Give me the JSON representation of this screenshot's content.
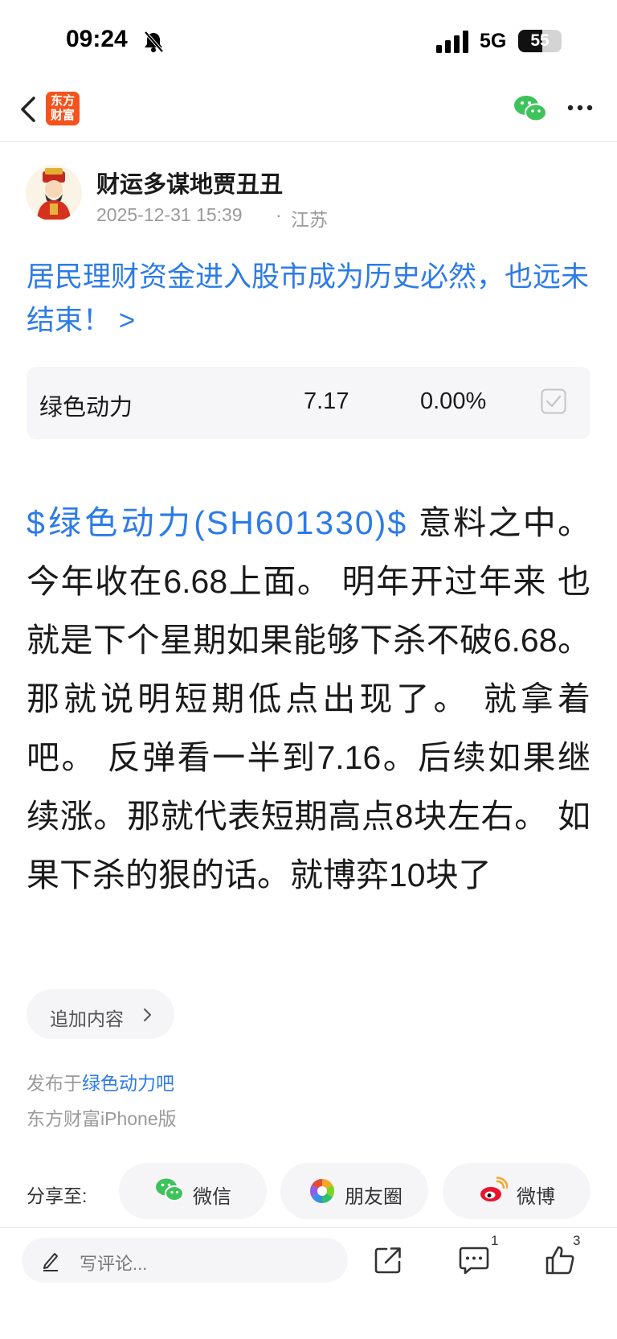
{
  "status_bar": {
    "time": "09:24",
    "network": "5G",
    "battery_level": "55",
    "battery_fraction": 0.55
  },
  "nav": {
    "logo_line1": "东方",
    "logo_line2": "财富",
    "icons": [
      "back-icon",
      "wechat-icon",
      "more-icon"
    ]
  },
  "post": {
    "author_name": "财运多谋地贾丑丑",
    "time": "2025-12-31 15:39",
    "separator": "·",
    "location": "江苏",
    "title": "居民理财资金进入股市成为历史必然，也远未结束！ >",
    "stock_link": "$绿色动力(SH601330)$",
    "body": "  意料之中。今年收在6.68上面。 明年开过年来  也就是下个星期如果能够下杀不破6.68。 那就说明短期低点出现了。 就拿着吧。 反弹看一半到7.16。后续如果继续涨。那就代表短期高点8块左右。 如果下杀的狠的话。就博弈10块了"
  },
  "stock_card": {
    "name": "绿色动力",
    "price": "7.17",
    "change": "0.00%",
    "checked": true
  },
  "append": {
    "label": "追加内容"
  },
  "meta": {
    "publish_prefix": "发布于",
    "bar_name": "绿色动力吧",
    "client": "东方财富iPhone版"
  },
  "share": {
    "label": "分享至:",
    "wechat": "微信",
    "moments": "朋友圈",
    "weibo": "微博"
  },
  "bottom_bar": {
    "comment_placeholder": "写评论...",
    "comment_count": "1",
    "like_count": "3"
  },
  "colors": {
    "link_blue": "#2c7be8",
    "brand_orange": "#f4541c",
    "wechat_green": "#3ec35b",
    "weibo_red": "#e6162d"
  }
}
